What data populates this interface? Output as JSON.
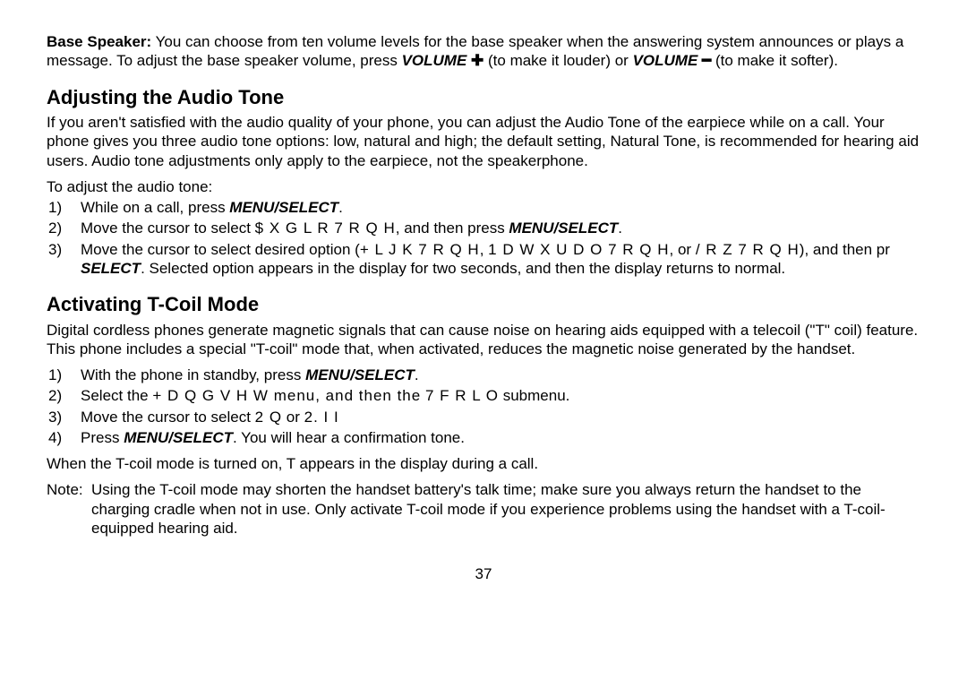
{
  "baseSpeaker": {
    "label": "Base Speaker:",
    "text1": " You can choose from ten volume levels for the base speaker when the answering system announces or plays a message. To adjust the base speaker volume, press ",
    "volPlus": "VOLUME ",
    "plusSym": "✚",
    "text2": " (to make it louder) or ",
    "volMinus": "VOLUME ",
    "minusSym": "━",
    "text3": " (to make it softer)."
  },
  "heading1": "Adjusting the Audio Tone",
  "audioToneIntro": "If you aren't satisfied with the audio quality of your phone, you can adjust the Audio Tone of the earpiece while on a call. Your phone gives you three audio tone options: low, natural and high; the default setting, Natural Tone, is recommended for hearing aid users. Audio tone adjustments only apply to the earpiece, not the speakerphone.",
  "audioToneLead": "To adjust the audio tone:",
  "step1a": "While on a call, press ",
  "menuSelect": "MENU/SELECT",
  "step1b": ".",
  "step2a": "Move the cursor to select ",
  "step2code": "$ X G L R   7 R Q H",
  "step2b": ", and then press ",
  "step2c": ".",
  "step3a": "Move the cursor to select desired option (",
  "step3code1": "+ L J K   7 R Q H",
  "step3mid1": ", ",
  "step3code2": "1 D W X U D O   7 R Q H",
  "step3mid2": ", or ",
  "step3code3": "/ R Z   7 R Q H",
  "step3b": "), and then pr",
  "selectWord": "SELECT",
  "step3c": ". Selected option appears in the display for two seconds, and then the display returns to normal.",
  "heading2": "Activating T-Coil Mode",
  "tcoilIntro": "Digital cordless phones generate magnetic signals that can cause noise on hearing aids equipped with a telecoil (\"T\" coil) feature. This phone includes a special \"T-coil\" mode that, when activated, reduces the magnetic noise generated by the handset.",
  "tstep1a": "With the phone in standby, press ",
  "tstep1b": ".",
  "tstep2a": "Select the ",
  "tstep2code1": "+ D Q G V H W menu, and then the",
  "tstep2mid": "",
  "tstep2code2": "7   F R L O",
  "tstep2b": " submenu.",
  "tstep3a": "Move the cursor to select ",
  "tstep3code1": "2 Q",
  "tstep3mid": " or ",
  "tstep3code2": "2. I I",
  "tstep4a": "Press ",
  "tstep4b": ". You will hear a confirmation tone.",
  "tcoilOn1": "When the T-coil mode is turned on, ",
  "tcoilGlyph": "T",
  "tcoilOn2": " appears in the display during a call.",
  "noteLabel": "Note:",
  "noteBody": "Using the T-coil mode may shorten the handset battery's talk time; make sure you always return the handset to the charging cradle when not in use. Only activate T-coil mode if you experience problems using the handset with a T-coil-equipped hearing aid.",
  "pageNum": "37"
}
